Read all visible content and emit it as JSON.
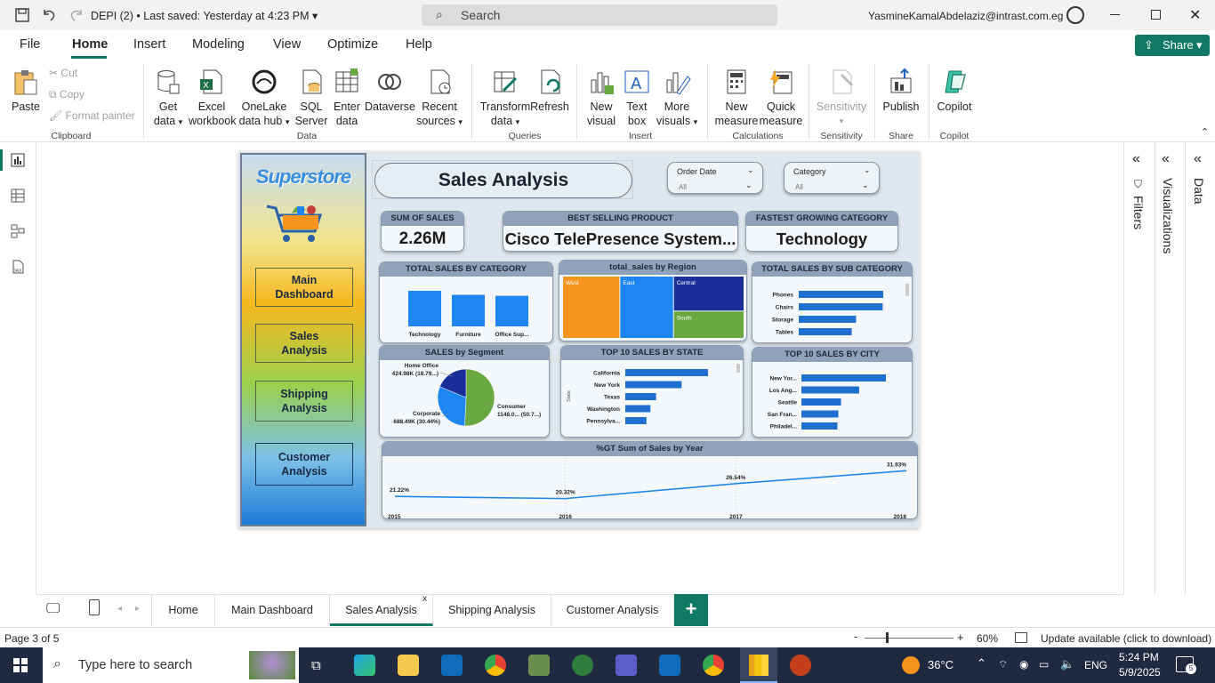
{
  "titlebar": {
    "title": "DEPI (2)",
    "saved": "Last saved: Yesterday at 4:23 PM",
    "search_placeholder": "Search",
    "user": "YasmineKamalAbdelaziz@intrast.com.eg"
  },
  "menu": {
    "tabs": [
      "File",
      "Home",
      "Insert",
      "Modeling",
      "View",
      "Optimize",
      "Help"
    ],
    "share": "Share"
  },
  "ribbon": {
    "paste": "Paste",
    "cut": "Cut",
    "copy": "Copy",
    "format_painter": "Format painter",
    "clipboard": "Clipboard",
    "get_data": "Get",
    "get_data2": "data",
    "excel": "Excel",
    "excel2": "workbook",
    "onelake": "OneLake",
    "onelake2": "data hub",
    "sql": "SQL",
    "sql2": "Server",
    "enter": "Enter",
    "enter2": "data",
    "dataverse": "Dataverse",
    "recent": "Recent",
    "recent2": "sources",
    "data_group": "Data",
    "transform": "Transform",
    "transform2": "data",
    "refresh": "Refresh",
    "queries": "Queries",
    "new_visual": "New",
    "new_visual2": "visual",
    "text_box": "Text",
    "text_box2": "box",
    "more_visuals": "More",
    "more_visuals2": "visuals",
    "insert_group": "Insert",
    "new_measure": "New",
    "new_measure2": "measure",
    "quick_measure": "Quick",
    "quick_measure2": "measure",
    "calculations": "Calculations",
    "sensitivity": "Sensitivity",
    "sensitivity_group": "Sensitivity",
    "publish": "Publish",
    "share_group": "Share",
    "copilot": "Copilot",
    "copilot_group": "Copilot"
  },
  "panes": {
    "filters": "Filters",
    "visualizations": "Visualizations",
    "data": "Data"
  },
  "report": {
    "logo": "Superstore",
    "title": "Sales Analysis",
    "nav": [
      {
        "line1": "Main",
        "line2": "Dashboard"
      },
      {
        "line1": "Sales",
        "line2": "Analysis"
      },
      {
        "line1": "Shipping",
        "line2": "Analysis"
      },
      {
        "line1": "Customer",
        "line2": "Analysis"
      }
    ],
    "slicers": [
      {
        "label": "Order Date",
        "value": "All"
      },
      {
        "label": "Category",
        "value": "All"
      }
    ],
    "kpis": [
      {
        "label": "SUM OF SALES",
        "value": "2.26M"
      },
      {
        "label": "BEST SELLING PRODUCT",
        "value": "Cisco TelePresence System..."
      },
      {
        "label": "FASTEST GROWING CATEGORY",
        "value": "Technology"
      }
    ]
  },
  "chart_data": [
    {
      "type": "bar",
      "title": "TOTAL SALES BY CATEGORY",
      "categories": [
        "Technology",
        "Furniture",
        "Office Sup..."
      ],
      "values": [
        836,
        742,
        719
      ]
    },
    {
      "type": "treemap",
      "title": "total_sales by Region",
      "categories": [
        "West",
        "East",
        "Central",
        "South"
      ],
      "values": [
        725,
        679,
        501,
        392
      ],
      "colors": [
        "#f7941d",
        "#1e86f0",
        "#1a2e9a",
        "#6aa842"
      ]
    },
    {
      "type": "bar",
      "orientation": "horizontal",
      "title": "TOTAL SALES BY SUB CATEGORY",
      "categories": [
        "Phones",
        "Chairs",
        "Storage",
        "Tables"
      ],
      "values": [
        330,
        328,
        224,
        207
      ]
    },
    {
      "type": "pie",
      "title": "SALES by Segment",
      "categories": [
        "Consumer",
        "Corporate",
        "Home Office"
      ],
      "labels": [
        "1148.0... (50.7...)",
        "688.49K (30.44%)",
        "424.98K (18.79...)"
      ],
      "values": [
        50.77,
        30.44,
        18.79
      ],
      "colors": [
        "#6aa842",
        "#1e86f0",
        "#1a2e9a"
      ]
    },
    {
      "type": "bar",
      "orientation": "horizontal",
      "title": "TOP 10 SALES BY STATE",
      "ylabel": "State",
      "categories": [
        "California",
        "New York",
        "Texas",
        "Washington",
        "Pennsylva..."
      ],
      "values": [
        457,
        311,
        170,
        139,
        117
      ]
    },
    {
      "type": "bar",
      "orientation": "horizontal",
      "title": "TOP 10 SALES BY CITY",
      "categories": [
        "New Yor...",
        "Los Ang...",
        "Seattle",
        "San Fran...",
        "Philadel..."
      ],
      "values": [
        256,
        175,
        120,
        112,
        109
      ]
    },
    {
      "type": "line",
      "title": "%GT Sum of Sales by Year",
      "x": [
        "2015",
        "2016",
        "2017",
        "2018"
      ],
      "y": [
        21.22,
        20.32,
        26.54,
        31.93
      ],
      "labels": [
        "21.22%",
        "20.32%",
        "26.54%",
        "31.93%"
      ]
    }
  ],
  "pagetabs": [
    "Home",
    "Main Dashboard",
    "Sales Analysis",
    "Shipping Analysis",
    "Customer Analysis"
  ],
  "status": {
    "page": "Page 3 of 5",
    "zoom": "60%",
    "update": "Update available (click to download)"
  },
  "taskbar": {
    "search": "Type here to search",
    "weather": "36°C",
    "lang": "ENG",
    "time": "5:24 PM",
    "date": "5/9/2025",
    "notif": "5"
  },
  "colors": {
    "accent": "#117865",
    "bar_blue": "#1e86f0",
    "header": "#8fa2b9"
  }
}
